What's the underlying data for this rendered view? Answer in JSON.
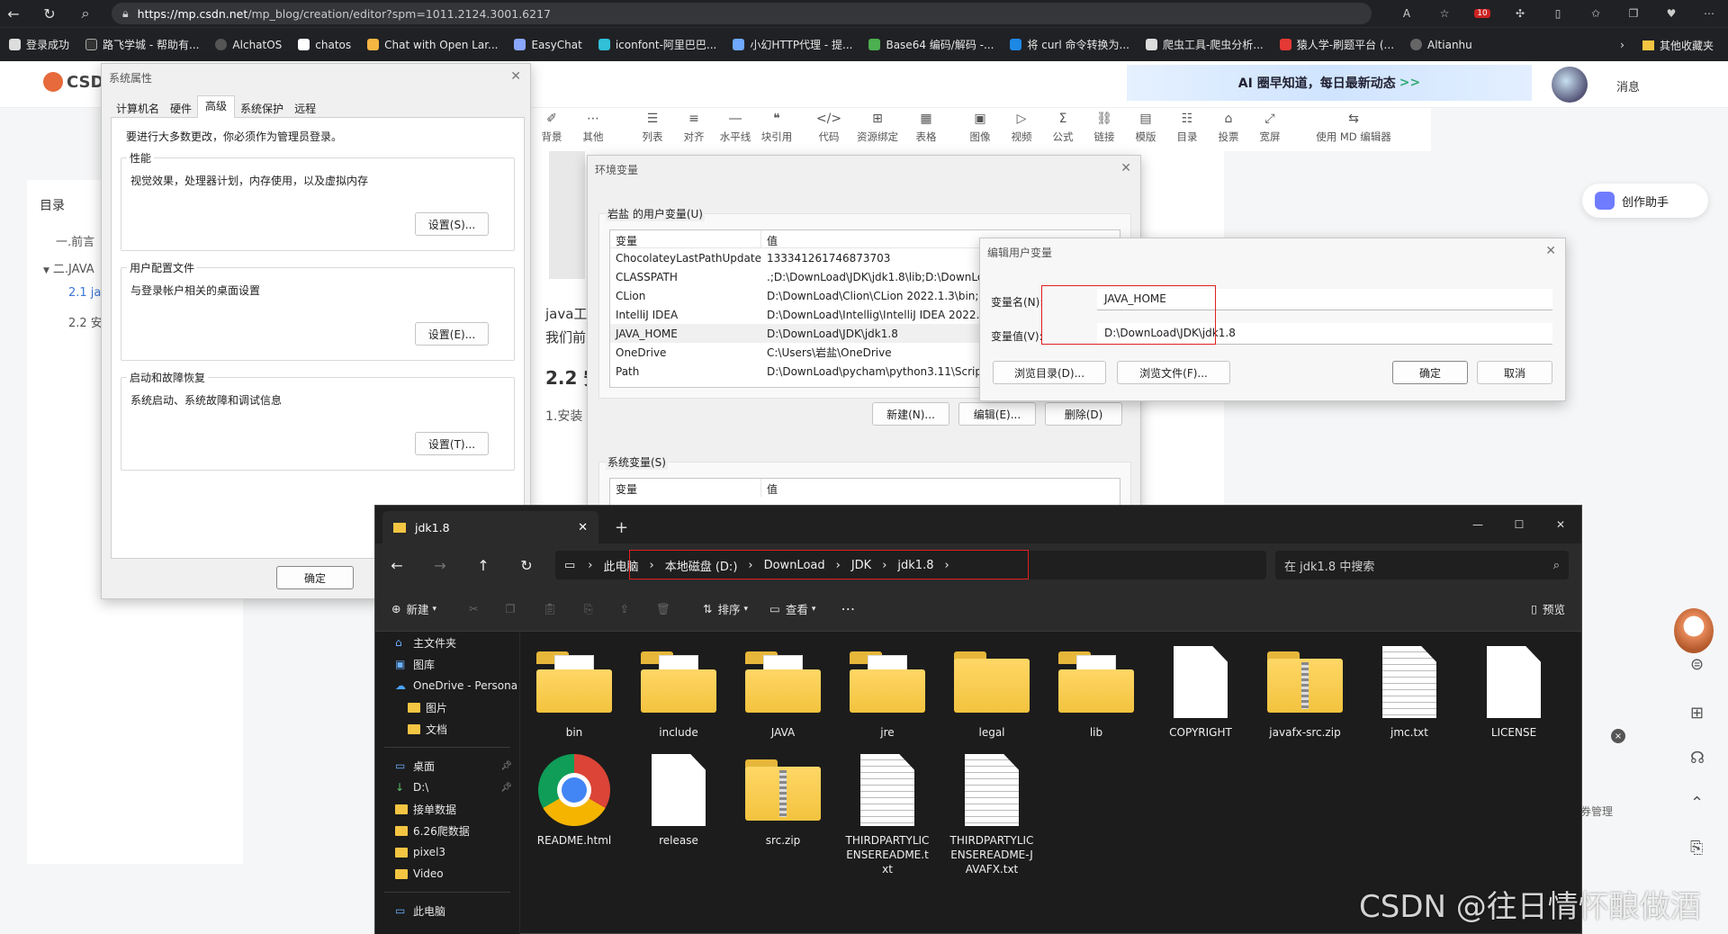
{
  "browser": {
    "url_host": "https://mp.csdn.net",
    "url_path": "/mp_blog/creation/editor?spm=1011.2124.3001.6217",
    "bookmarks": [
      "登录成功",
      "路飞学城 - 帮助有...",
      "AlchatOS",
      "chatos",
      "Chat with Open Lar...",
      "EasyChat",
      "iconfont-阿里巴巴...",
      "小幻HTTP代理 - 提...",
      "Base64 编码/解码 -...",
      "将 curl 命令转换为...",
      "爬虫工具-爬虫分析...",
      "猿人学-刷题平台 (...",
      "Altianhu"
    ],
    "bookmarks_more": "其他收藏夹"
  },
  "csdn": {
    "logo": "CSD",
    "banner": "AI 圈早知道，每日最新动态",
    "messages": "消息",
    "assistant": "创作助手",
    "toolbar": [
      "背景",
      "其他",
      "列表",
      "对齐",
      "水平线",
      "块引用",
      "代码",
      "资源绑定",
      "表格",
      "图像",
      "视频",
      "公式",
      "链接",
      "模版",
      "目录",
      "投票",
      "宽屏",
      "使用 MD 编辑器"
    ],
    "toc_title": "目录",
    "toc_items": [
      "一.前言",
      "二.JAVA",
      "2.1 ja",
      "2.2 安"
    ],
    "article_lines": [
      "java工",
      "我们前",
      "2.2 安",
      "1.安装"
    ],
    "side_label": "券管理",
    "watermark": "CSDN @往日情怀酿做酒"
  },
  "sysprops": {
    "title": "系统属性",
    "tabs": [
      "计算机名",
      "硬件",
      "高级",
      "系统保护",
      "远程"
    ],
    "active_tab": 2,
    "notice": "要进行大多数更改，你必须作为管理员登录。",
    "groups": [
      {
        "label": "性能",
        "desc": "视觉效果，处理器计划，内存使用，以及虚拟内存",
        "button": "设置(S)..."
      },
      {
        "label": "用户配置文件",
        "desc": "与登录帐户相关的桌面设置",
        "button": "设置(E)..."
      },
      {
        "label": "启动和故障恢复",
        "desc": "系统启动、系统故障和调试信息",
        "button": "设置(T)..."
      }
    ],
    "ok": "确定"
  },
  "envvars": {
    "title": "环境变量",
    "user_label": "岩盐 的用户变量(U)",
    "col_var": "变量",
    "col_val": "值",
    "user_rows": [
      {
        "name": "ChocolateyLastPathUpdate",
        "value": "133341261746873703"
      },
      {
        "name": "CLASSPATH",
        "value": ".;D:\\DownLoad\\JDK\\jdk1.8\\lib;D:\\DownLo"
      },
      {
        "name": "CLion",
        "value": "D:\\DownLoad\\Clion\\CLion 2022.1.3\\bin;"
      },
      {
        "name": "IntelliJ IDEA",
        "value": "D:\\DownLoad\\Intellig\\IntelliJ IDEA 2022.1"
      },
      {
        "name": "JAVA_HOME",
        "value": "D:\\DownLoad\\JDK\\jdk1.8"
      },
      {
        "name": "OneDrive",
        "value": "C:\\Users\\岩盐\\OneDrive"
      },
      {
        "name": "Path",
        "value": "D:\\DownLoad\\pycham\\python3.11\\Script"
      }
    ],
    "selected_row": 4,
    "btn_new": "新建(N)...",
    "btn_edit": "编辑(E)...",
    "btn_delete": "删除(D)",
    "sys_label": "系统变量(S)"
  },
  "editvar": {
    "title": "编辑用户变量",
    "name_label": "变量名(N):",
    "name_value": "JAVA_HOME",
    "value_label": "变量值(V):",
    "value_value": "D:\\DownLoad\\JDK\\jdk1.8",
    "browse_dir": "浏览目录(D)...",
    "browse_file": "浏览文件(F)...",
    "ok": "确定",
    "cancel": "取消"
  },
  "explorer": {
    "tab_title": "jdk1.8",
    "breadcrumb": [
      "此电脑",
      "本地磁盘 (D:)",
      "DownLoad",
      "JDK",
      "jdk1.8"
    ],
    "search_placeholder": "在 jdk1.8 中搜索",
    "cmd_new": "新建",
    "cmd_sort": "排序",
    "cmd_view": "查看",
    "cmd_preview": "预览",
    "sidebar": [
      {
        "label": "主文件夹",
        "kind": "home"
      },
      {
        "label": "图库",
        "kind": "gallery"
      },
      {
        "label": "OneDrive - Persona",
        "kind": "cloud"
      },
      {
        "label": "图片",
        "kind": "folder"
      },
      {
        "label": "文档",
        "kind": "folder"
      },
      {
        "label": "桌面",
        "kind": "desktop"
      },
      {
        "label": "D:\\",
        "kind": "download"
      },
      {
        "label": "接单数据",
        "kind": "folder"
      },
      {
        "label": "6.26爬数据",
        "kind": "folder"
      },
      {
        "label": "pixel3",
        "kind": "folder"
      },
      {
        "label": "Video",
        "kind": "folder"
      },
      {
        "label": "此电脑",
        "kind": "pc"
      }
    ],
    "files": [
      {
        "name": "bin",
        "kind": "folder"
      },
      {
        "name": "include",
        "kind": "folder"
      },
      {
        "name": "JAVA",
        "kind": "folder"
      },
      {
        "name": "jre",
        "kind": "folder"
      },
      {
        "name": "legal",
        "kind": "folder-empty"
      },
      {
        "name": "lib",
        "kind": "folder"
      },
      {
        "name": "COPYRIGHT",
        "kind": "doc"
      },
      {
        "name": "javafx-src.zip",
        "kind": "zip"
      },
      {
        "name": "jmc.txt",
        "kind": "txt"
      },
      {
        "name": "LICENSE",
        "kind": "doc"
      },
      {
        "name": "README.html",
        "kind": "chrome"
      },
      {
        "name": "release",
        "kind": "doc"
      },
      {
        "name": "src.zip",
        "kind": "zip"
      },
      {
        "name": "THIRDPARTYLICENSEREADME.txt",
        "kind": "txt"
      },
      {
        "name": "THIRDPARTYLICENSEREADME-JAVAFX.txt",
        "kind": "txt"
      }
    ]
  }
}
